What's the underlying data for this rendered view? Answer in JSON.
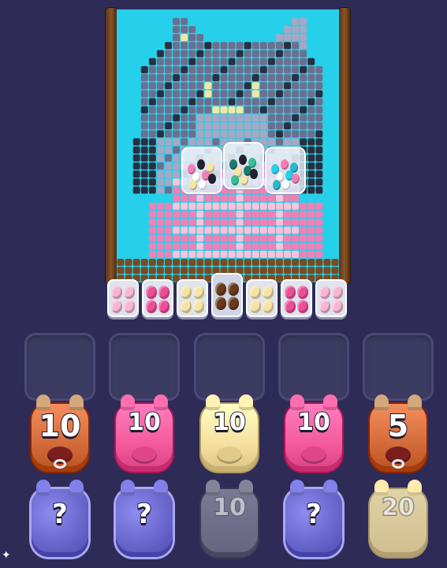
{
  "game": {
    "board_colors": {
      "background": "#26d0ea",
      "cat_dark": "#2b2e3e",
      "cat_fur": "#6e6e8e",
      "cat_light": "#a7a7c4",
      "cat_highlight": "#f4e7a2",
      "shirt_pink": "#f37fb6",
      "shirt_light": "#f9c2d8",
      "floor": "#7a4a22"
    },
    "board_jars": [
      {
        "name": "jar-mixed-1",
        "colors": [
          "#f37fb6",
          "#222233",
          "#f4e7a2",
          "#ffffff"
        ]
      },
      {
        "name": "jar-mixed-2",
        "colors": [
          "#1f7b6c",
          "#222233",
          "#3bbf98",
          "#f4e7a2"
        ]
      },
      {
        "name": "jar-mixed-3",
        "colors": [
          "#26d0ea",
          "#f37fb6",
          "#2ab8cc",
          "#ffffff"
        ]
      }
    ],
    "egg_trays": [
      {
        "name": "tray-pink-light",
        "color": "#f7b7d2"
      },
      {
        "name": "tray-pink",
        "color": "#ec4f96"
      },
      {
        "name": "tray-cream",
        "color": "#f6e4a6"
      },
      {
        "name": "tray-brown",
        "color": "#6b3a1a",
        "active": true
      },
      {
        "name": "tray-cream-2",
        "color": "#f6e4a6"
      },
      {
        "name": "tray-pink-2",
        "color": "#ec4f96"
      },
      {
        "name": "tray-pink-light-2",
        "color": "#f7b7d2"
      }
    ],
    "empty_slots": 5,
    "front_row": [
      {
        "name": "creature-bull-10",
        "kind": "bull",
        "count": "10",
        "color": "#d26a3a"
      },
      {
        "name": "creature-pink-10",
        "kind": "pig",
        "count": "10",
        "color": "#f35a9c"
      },
      {
        "name": "creature-cream-10",
        "kind": "pig",
        "count": "10",
        "color": "#f5dfa0"
      },
      {
        "name": "creature-pink-10-b",
        "kind": "pig",
        "count": "10",
        "color": "#f35a9c"
      },
      {
        "name": "creature-bull-5",
        "kind": "bull",
        "count": "5",
        "color": "#d26a3a"
      }
    ],
    "back_row": [
      {
        "name": "creature-mystery-1",
        "kind": "mystery",
        "count": "?",
        "color": "#6f6cd6"
      },
      {
        "name": "creature-mystery-2",
        "kind": "mystery",
        "count": "?",
        "color": "#6f6cd6"
      },
      {
        "name": "creature-gray-10",
        "kind": "locked",
        "count": "10",
        "color": "#6f6f86"
      },
      {
        "name": "creature-mystery-3",
        "kind": "mystery",
        "count": "?",
        "color": "#6f6cd6"
      },
      {
        "name": "creature-cream-20",
        "kind": "locked",
        "count": "20",
        "color": "#eed79a"
      }
    ]
  }
}
